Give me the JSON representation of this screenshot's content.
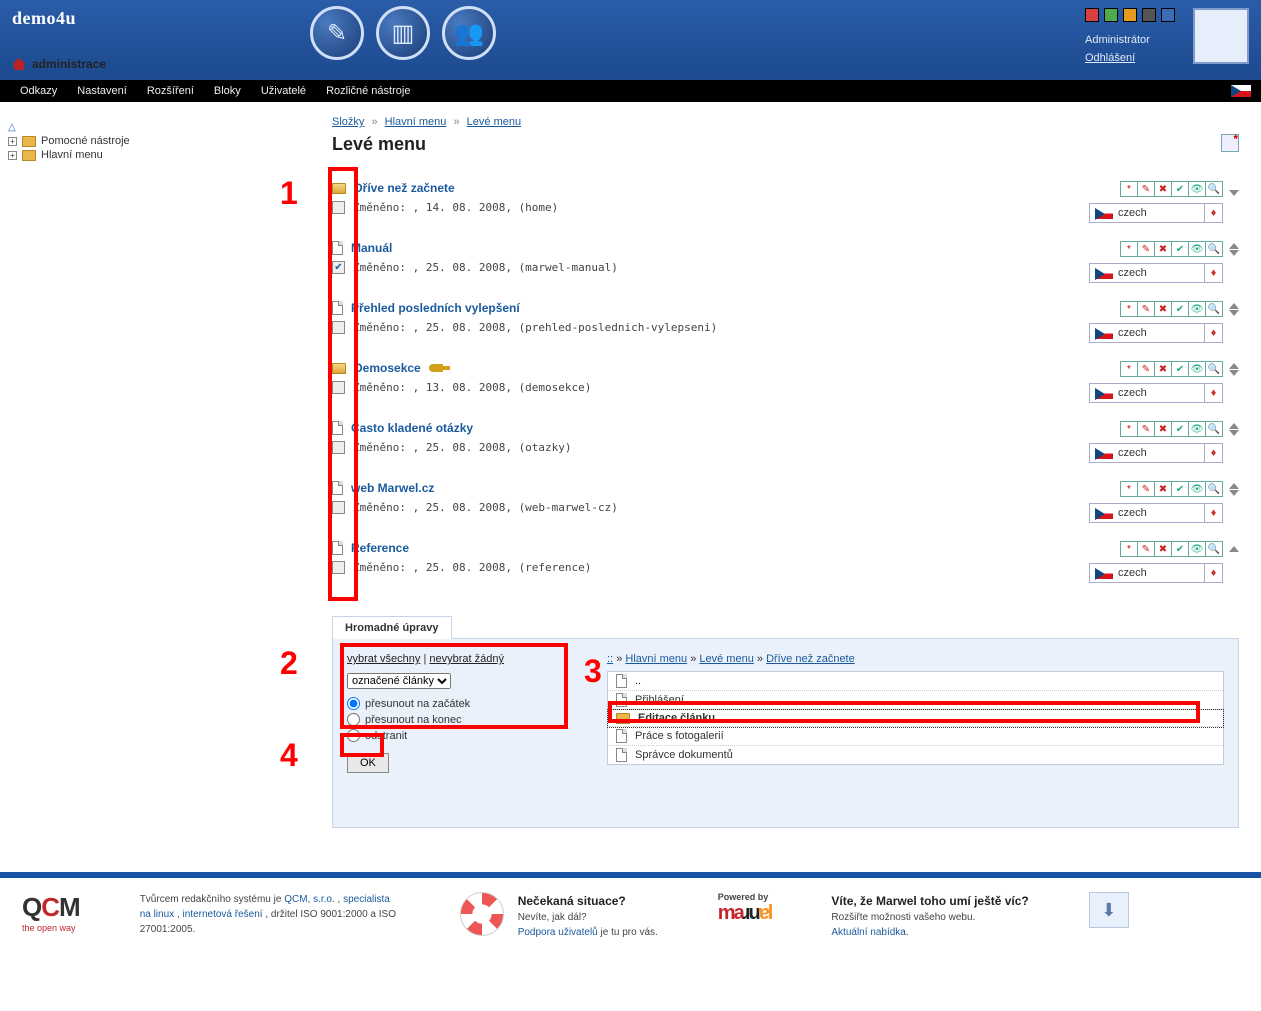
{
  "header": {
    "brand": "demo4u",
    "home_label": "administrace",
    "admin_role": "Administrátor",
    "logout": "Odhlášení",
    "color_squares": [
      "#d94040",
      "#4fa94f",
      "#e69a1f",
      "#555",
      "#3a6db5"
    ]
  },
  "topnav": {
    "items": [
      "Odkazy",
      "Nastavení",
      "Rozšíření",
      "Bloky",
      "Uživatelé",
      "Rozličné nástroje"
    ]
  },
  "sidebar": {
    "items": [
      {
        "label": "Pomocné nástroje"
      },
      {
        "label": "Hlavní menu"
      }
    ]
  },
  "breadcrumbs": {
    "parts": [
      "Složky",
      "Hlavní menu",
      "Levé menu"
    ]
  },
  "page_title": "Levé menu",
  "items": [
    {
      "icon": "folder",
      "title": "Dříve než začnete",
      "checked": false,
      "meta": "Změněno: , 14. 08. 2008, (home)",
      "up": false,
      "down": true,
      "lang": "czech"
    },
    {
      "icon": "doc",
      "title": "Manuál",
      "checked": true,
      "meta": "Změněno: , 25. 08. 2008, (marwel-manual)",
      "up": true,
      "down": true,
      "lang": "czech"
    },
    {
      "icon": "doc",
      "title": "Přehled posledních vylepšení",
      "checked": false,
      "meta": "Změněno: , 25. 08. 2008, (prehled-poslednich-vylepseni)",
      "up": true,
      "down": true,
      "lang": "czech"
    },
    {
      "icon": "folder",
      "title": "Demosekce",
      "key": true,
      "checked": false,
      "meta": "Změněno: , 13. 08. 2008, (demosekce)",
      "up": true,
      "down": true,
      "lang": "czech"
    },
    {
      "icon": "doc",
      "title": "Často kladené otázky",
      "checked": false,
      "meta": "Změněno: , 25. 08. 2008, (otazky)",
      "up": true,
      "down": true,
      "lang": "czech"
    },
    {
      "icon": "doc",
      "title": "web Marwel.cz",
      "checked": false,
      "meta": "Změněno: , 25. 08. 2008, (web-marwel-cz)",
      "up": true,
      "down": true,
      "lang": "czech"
    },
    {
      "icon": "doc",
      "title": "Reference",
      "checked": false,
      "meta": "Změněno: , 25. 08. 2008, (reference)",
      "up": true,
      "down": false,
      "lang": "czech"
    }
  ],
  "bulk": {
    "tab": "Hromadné úpravy",
    "select_all": "vybrat všechny",
    "select_none": "nevybrat žádný",
    "dropdown": "označené články",
    "radios": [
      "přesunout na začátek",
      "přesunout na konec",
      "odstranit"
    ],
    "ok": "OK",
    "crumbs": [
      "::",
      "Hlavní menu",
      "Levé menu",
      "Dříve než začnete"
    ],
    "list": [
      {
        "icon": "doc",
        "label": ".."
      },
      {
        "icon": "doc",
        "label": "Přihlášení"
      },
      {
        "icon": "folder",
        "label": "Editace článku",
        "sel": true
      },
      {
        "icon": "doc",
        "label": "Práce s fotogalerií"
      },
      {
        "icon": "doc",
        "label": "Správce dokumentů"
      }
    ]
  },
  "annotations": {
    "n1": "1",
    "n2": "2",
    "n3": "3",
    "n4": "4"
  },
  "footer": {
    "qcm_tag": "the open way",
    "qcm_text_pre": "Tvůrcem redakčního systému je ",
    "qcm_link1": "QCM, s.r.o.",
    "qcm_text_mid": ", ",
    "qcm_link2": "specialista na linux",
    "qcm_text_mid2": ", ",
    "qcm_link3": "internetová řešení",
    "qcm_text_post": ", držitel ISO 9001:2000 a ISO 27001:2005.",
    "help_title": "Nečekaná situace?",
    "help_sub": "Nevíte, jak dál?",
    "help_link": "Podpora uživatelů",
    "help_post": " je tu pro vás.",
    "powered": "Powered by",
    "promo_title": "Víte, že Marwel toho umí ještě víc?",
    "promo_sub": "Rozšiřte možnosti vašeho webu.",
    "promo_link": "Aktuální nabídka"
  }
}
